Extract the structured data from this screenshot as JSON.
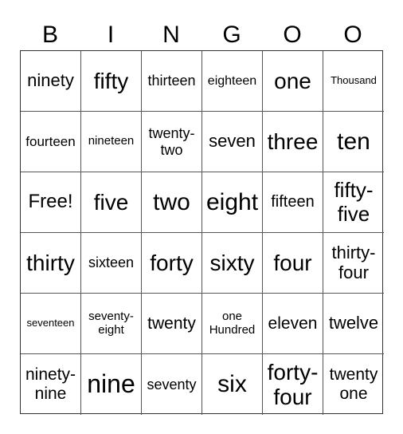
{
  "header": [
    "B",
    "I",
    "N",
    "G",
    "O",
    "O"
  ],
  "cells": [
    "ninety",
    "fifty",
    "thirteen",
    "eighteen",
    "one",
    "Thousand",
    "fourteen",
    "nineteen",
    "twenty-two",
    "seven",
    "three",
    "ten",
    "Free!",
    "five",
    "two",
    "eight",
    "fifteen",
    "fifty-five",
    "thirty",
    "sixteen",
    "forty",
    "sixty",
    "four",
    "thirty-four",
    "seventeen",
    "seventy-eight",
    "twenty",
    "one Hundred",
    "eleven",
    "twelve",
    "ninety-nine",
    "nine",
    "seventy",
    "six",
    "forty-four",
    "twenty one"
  ]
}
